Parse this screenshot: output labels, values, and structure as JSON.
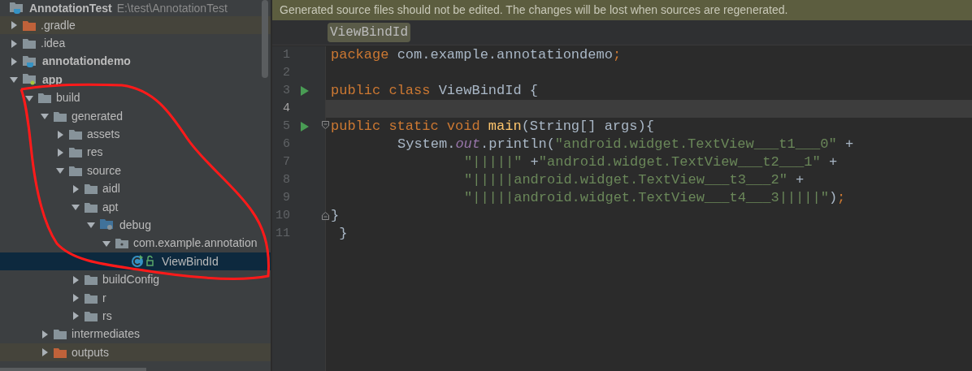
{
  "project": {
    "name": "AnnotationTest",
    "path": "E:\\test\\AnnotationTest"
  },
  "tree": [
    {
      "label": ".gradle",
      "kind": "excluded",
      "expanded": false,
      "selected": false
    },
    {
      "label": ".idea",
      "kind": "folder",
      "expanded": false,
      "selected": false
    },
    {
      "label": "annotationdemo",
      "kind": "module",
      "expanded": false,
      "selected": false
    },
    {
      "label": "app",
      "kind": "app-module",
      "expanded": true,
      "selected": false,
      "children": [
        {
          "label": "build",
          "kind": "folder",
          "expanded": true,
          "selected": false,
          "children": [
            {
              "label": "generated",
              "kind": "folder",
              "expanded": true,
              "selected": false,
              "children": [
                {
                  "label": "assets",
                  "kind": "folder",
                  "expanded": false,
                  "selected": false
                },
                {
                  "label": "res",
                  "kind": "folder",
                  "expanded": false,
                  "selected": false
                },
                {
                  "label": "source",
                  "kind": "folder",
                  "expanded": true,
                  "selected": false,
                  "children": [
                    {
                      "label": "aidl",
                      "kind": "folder",
                      "expanded": false,
                      "selected": false
                    },
                    {
                      "label": "apt",
                      "kind": "folder",
                      "expanded": true,
                      "selected": false,
                      "children": [
                        {
                          "label": "debug",
                          "kind": "source-root",
                          "expanded": true,
                          "selected": false,
                          "children": [
                            {
                              "label": "com.example.annotation",
                              "kind": "package",
                              "expanded": true,
                              "selected": false,
                              "children": [
                                {
                                  "label": "ViewBindId",
                                  "kind": "class",
                                  "selected": true
                                }
                              ]
                            }
                          ]
                        }
                      ]
                    },
                    {
                      "label": "buildConfig",
                      "kind": "folder",
                      "expanded": false,
                      "selected": false
                    },
                    {
                      "label": "r",
                      "kind": "folder",
                      "expanded": false,
                      "selected": false
                    },
                    {
                      "label": "rs",
                      "kind": "folder",
                      "expanded": false,
                      "selected": false
                    }
                  ]
                }
              ]
            },
            {
              "label": "intermediates",
              "kind": "folder",
              "expanded": false,
              "selected": false
            },
            {
              "label": "outputs",
              "kind": "excluded",
              "expanded": false,
              "selected": false
            }
          ]
        }
      ]
    }
  ],
  "notification": "Generated source files should not be edited. The changes will be lost when sources are regenerated.",
  "breadcrumb": "ViewBindId",
  "code_lines": [
    {
      "number": "1",
      "kind": "top",
      "run": false,
      "fold_open": false,
      "fold_close": false,
      "current": false,
      "tokens": [
        {
          "kind": "keyword",
          "text": "package "
        },
        {
          "kind": "plain",
          "text": "com.example.annotationdemo"
        },
        {
          "kind": "keyword",
          "text": ";"
        }
      ]
    },
    {
      "number": "2",
      "kind": "top",
      "run": false,
      "fold_open": false,
      "fold_close": false,
      "current": false
    },
    {
      "number": "3",
      "kind": "top",
      "run": true,
      "fold_open": false,
      "fold_close": false,
      "current": false,
      "tokens": [
        {
          "kind": "keyword",
          "text": "public class "
        },
        {
          "kind": "plain",
          "text": "ViewBindId {"
        }
      ]
    },
    {
      "number": "4",
      "kind": "top",
      "run": false,
      "fold_open": false,
      "fold_close": false,
      "current": true
    },
    {
      "number": "5",
      "kind": "top",
      "run": true,
      "fold_open": true,
      "fold_close": false,
      "current": false,
      "tokens": [
        {
          "kind": "keyword",
          "text": "public static void "
        },
        {
          "kind": "method",
          "text": "main"
        },
        {
          "kind": "plain",
          "text": "(String[] args){"
        }
      ]
    },
    {
      "number": "6",
      "kind": "statement",
      "run": false,
      "fold_open": false,
      "fold_close": false,
      "current": false,
      "tokens": [
        {
          "kind": "plain",
          "text": "System."
        },
        {
          "kind": "field",
          "text": "out"
        },
        {
          "kind": "plain",
          "text": ".println("
        },
        {
          "kind": "string",
          "text": "\"android.widget.TextView___t1___0\""
        },
        {
          "kind": "plain",
          "text": " +"
        }
      ]
    },
    {
      "number": "7",
      "kind": "continuation",
      "run": false,
      "fold_open": false,
      "fold_close": false,
      "current": false,
      "tokens": [
        {
          "kind": "string",
          "text": "\"|||||\""
        },
        {
          "kind": "plain",
          "text": " +"
        },
        {
          "kind": "string",
          "text": "\"android.widget.TextView___t2___1\""
        },
        {
          "kind": "plain",
          "text": " +"
        }
      ]
    },
    {
      "number": "8",
      "kind": "continuation",
      "run": false,
      "fold_open": false,
      "fold_close": false,
      "current": false,
      "tokens": [
        {
          "kind": "string",
          "text": "\"|||||android.widget.TextView___t3___2\""
        },
        {
          "kind": "plain",
          "text": " +"
        }
      ]
    },
    {
      "number": "9",
      "kind": "continuation",
      "run": false,
      "fold_open": false,
      "fold_close": false,
      "current": false,
      "tokens": [
        {
          "kind": "string",
          "text": "\"|||||android.widget.TextView___t4___3|||||\""
        },
        {
          "kind": "plain",
          "text": ")"
        },
        {
          "kind": "keyword",
          "text": ";"
        }
      ]
    },
    {
      "number": "10",
      "kind": "top",
      "run": false,
      "fold_open": false,
      "fold_close": true,
      "current": false,
      "tokens": [
        {
          "kind": "plain",
          "text": "}"
        }
      ]
    },
    {
      "number": "11",
      "kind": "top",
      "run": false,
      "fold_open": false,
      "fold_close": false,
      "current": false,
      "tokens": [
        {
          "kind": "plain",
          "text": " }"
        }
      ]
    }
  ]
}
